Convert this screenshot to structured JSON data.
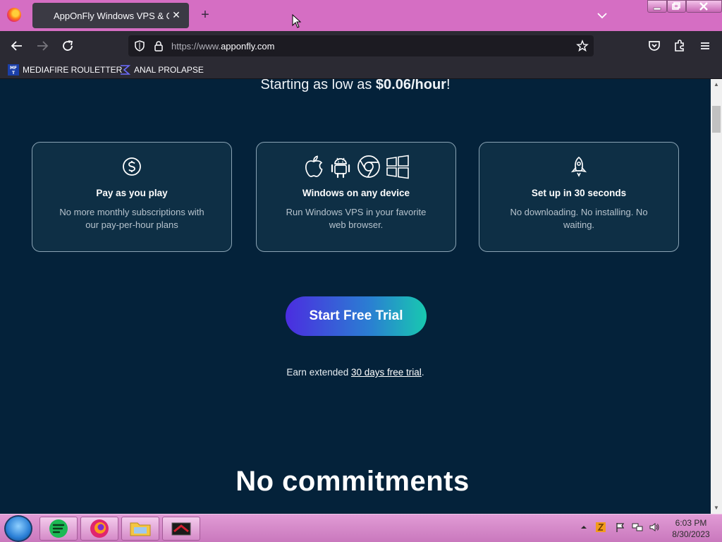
{
  "browser": {
    "tab_title": "AppOnFly Windows VPS & Cloud",
    "url_prefix": "https://www.",
    "url_domain": "apponfly.com",
    "bookmarks": [
      "MEDIAFIRE ROULETTER",
      "ANAL PROLAPSE"
    ]
  },
  "page": {
    "tagline_prefix": "Starting as low as ",
    "tagline_price": "$0.06/hour",
    "tagline_suffix": "!",
    "cards": [
      {
        "title": "Pay as you play",
        "desc": "No more monthly subscriptions with our pay-per-hour plans",
        "icons": [
          "dollar-circle-icon"
        ]
      },
      {
        "title": "Windows on any device",
        "desc": "Run Windows VPS in your favorite web browser.",
        "icons": [
          "apple-icon",
          "android-icon",
          "chrome-icon",
          "windows-icon"
        ]
      },
      {
        "title": "Set up in 30 seconds",
        "desc": "No downloading. No installing. No waiting.",
        "icons": [
          "rocket-icon"
        ]
      }
    ],
    "cta_label": "Start Free Trial",
    "earn_prefix": "Earn extended ",
    "earn_link": "30 days free trial",
    "earn_suffix": ".",
    "heading": "No commitments"
  },
  "taskbar": {
    "time": "6:03 PM",
    "date": "8/30/2023"
  },
  "colors": {
    "titlebar": "#d56ec3",
    "page_bg": "#04223a",
    "cta_start": "#4b2de0",
    "cta_end": "#18c9b0"
  }
}
